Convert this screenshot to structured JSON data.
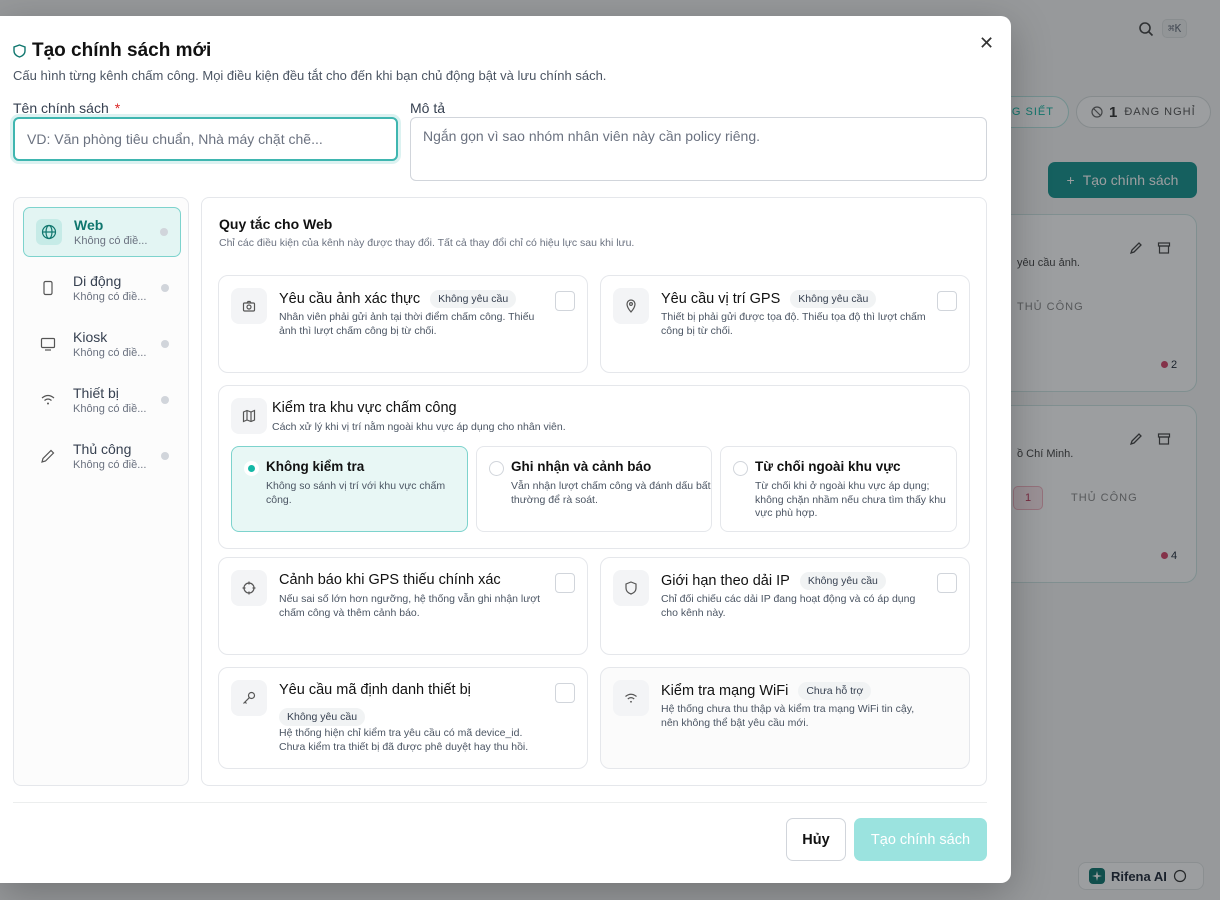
{
  "background": {
    "kbd": "⌘K",
    "pill_left": "NG SIẾT",
    "pill_right_count": "1",
    "pill_right_label": "ĐANG NGHỈ",
    "create_button": "Tạo chính sách",
    "card1": {
      "desc": "yêu cầu ảnh.",
      "manual": "THỦ CÔNG",
      "count": "2"
    },
    "card2": {
      "desc": "ồ Chí Minh.",
      "badge": "1",
      "manual": "THỦ CÔNG",
      "count": "4"
    },
    "ai_label": "Rifena AI"
  },
  "modal": {
    "title": "Tạo chính sách mới",
    "subtitle": "Cấu hình từng kênh chấm công. Mọi điều kiện đều tắt cho đến khi bạn chủ động bật và lưu chính sách.",
    "name_label": "Tên chính sách",
    "required_mark": "*",
    "name_placeholder": "VD: Văn phòng tiêu chuẩn, Nhà máy chặt chẽ...",
    "desc_label": "Mô tả",
    "desc_placeholder": "Ngắn gọn vì sao nhóm nhân viên này cần policy riêng.",
    "channels": [
      {
        "name": "Web",
        "sub": "Không có điề...",
        "icon": "globe-icon"
      },
      {
        "name": "Di động",
        "sub": "Không có điề...",
        "icon": "smartphone-icon"
      },
      {
        "name": "Kiosk",
        "sub": "Không có điề...",
        "icon": "monitor-icon"
      },
      {
        "name": "Thiết bị",
        "sub": "Không có điề...",
        "icon": "wifi-icon"
      },
      {
        "name": "Thủ công",
        "sub": "Không có điề...",
        "icon": "pencil-icon"
      }
    ],
    "panel_title": "Quy tắc cho Web",
    "panel_sub": "Chỉ các điều kiện của kênh này được thay đổi. Tất cả thay đổi chỉ có hiệu lực sau khi lưu.",
    "rules": {
      "photo": {
        "title": "Yêu cầu ảnh xác thực",
        "badge": "Không yêu cầu",
        "desc": "Nhân viên phải gửi ảnh tại thời điểm chấm công. Thiếu ảnh thì lượt chấm công bị từ chối."
      },
      "gps": {
        "title": "Yêu cầu vị trí GPS",
        "badge": "Không yêu cầu",
        "desc": "Thiết bị phải gửi được tọa độ. Thiếu tọa độ thì lượt chấm công bị từ chối."
      },
      "zone": {
        "title": "Kiểm tra khu vực chấm công",
        "desc": "Cách xử lý khi vị trí nằm ngoài khu vực áp dụng cho nhân viên.",
        "options": [
          {
            "title": "Không kiểm tra",
            "desc": "Không so sánh vị trí với khu vực chấm công."
          },
          {
            "title": "Ghi nhận và cảnh báo",
            "desc": "Vẫn nhận lượt chấm công và đánh dấu bất thường để rà soát."
          },
          {
            "title": "Từ chối ngoài khu vực",
            "desc": "Từ chối khi ở ngoài khu vực áp dụng; không chặn nhầm nếu chưa tìm thấy khu vực phù hợp."
          }
        ]
      },
      "accuracy": {
        "title": "Cảnh báo khi GPS thiếu chính xác",
        "desc": "Nếu sai số lớn hơn ngưỡng, hệ thống vẫn ghi nhận lượt chấm công và thêm cảnh báo."
      },
      "ip": {
        "title": "Giới hạn theo dải IP",
        "badge": "Không yêu cầu",
        "desc": "Chỉ đối chiếu các dải IP đang hoạt động và có áp dụng cho kênh này."
      },
      "device": {
        "title": "Yêu cầu mã định danh thiết bị",
        "badge": "Không yêu cầu",
        "desc": "Hệ thống hiện chỉ kiểm tra yêu cầu có mã device_id. Chưa kiểm tra thiết bị đã được phê duyệt hay thu hồi."
      },
      "wifi": {
        "title": "Kiểm tra mạng WiFi",
        "badge": "Chưa hỗ trợ",
        "desc": "Hệ thống chưa thu thập và kiểm tra mạng WiFi tin cậy, nên không thể bật yêu cầu mới."
      }
    },
    "cancel": "Hủy",
    "submit": "Tạo chính sách"
  }
}
